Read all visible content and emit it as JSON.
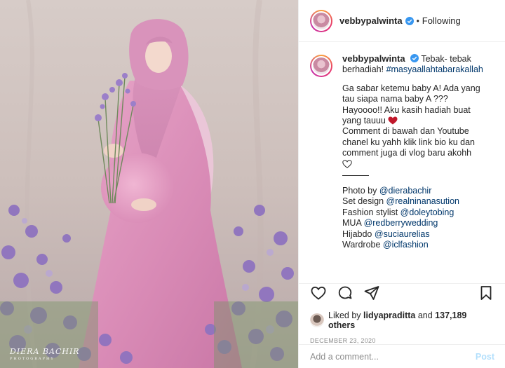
{
  "photo": {
    "alt_subject": "pregnant woman in pink dress and hijab holding purple flowers",
    "watermark": "DIERA BACHIR",
    "watermark_sub": "PHOTOGRAPHY"
  },
  "header": {
    "username": "vebbypalwinta",
    "verified": true,
    "separator": "•",
    "follow_status": "Following"
  },
  "caption": {
    "username": "vebbypalwinta",
    "title_text": "Tebak- tebak berhadiah!",
    "hashtag": "#masyaallahtabarakallah",
    "lines": [
      "Ga sabar ketemu baby A! Ada yang",
      "tau siapa nama baby A ???",
      "Hayoooo!! Aku kasih hadiah buat",
      "yang tauuu",
      "Comment di bawah dan Youtube",
      "chanel ku yahh klik link bio ku dan",
      "comment juga di vlog baru akohh"
    ],
    "credits": [
      {
        "label": "Photo by ",
        "mention": "@dierabachir"
      },
      {
        "label": "Set design ",
        "mention": "@realninanasution"
      },
      {
        "label": "Fashion stylist ",
        "mention": "@doleytobing"
      },
      {
        "label": "MUA ",
        "mention": "@redberrywedding"
      },
      {
        "label": "Hijabdo ",
        "mention": "@suciaurelias"
      },
      {
        "label": "Wardrobe ",
        "mention": "@iclfashion"
      }
    ]
  },
  "engagement": {
    "liked_by_prefix": "Liked by ",
    "liked_by_user": "lidyapraditta",
    "and_word": " and ",
    "others_count": "137,189 others",
    "date": "DECEMBER 23, 2020"
  },
  "comment_box": {
    "placeholder": "Add a comment...",
    "post_label": "Post"
  },
  "colors": {
    "link": "#00376b",
    "verified_blue": "#3897f0",
    "heart_red": "#c0182b",
    "post_disabled": "#b2dffc",
    "muted": "#8e8e8e"
  }
}
